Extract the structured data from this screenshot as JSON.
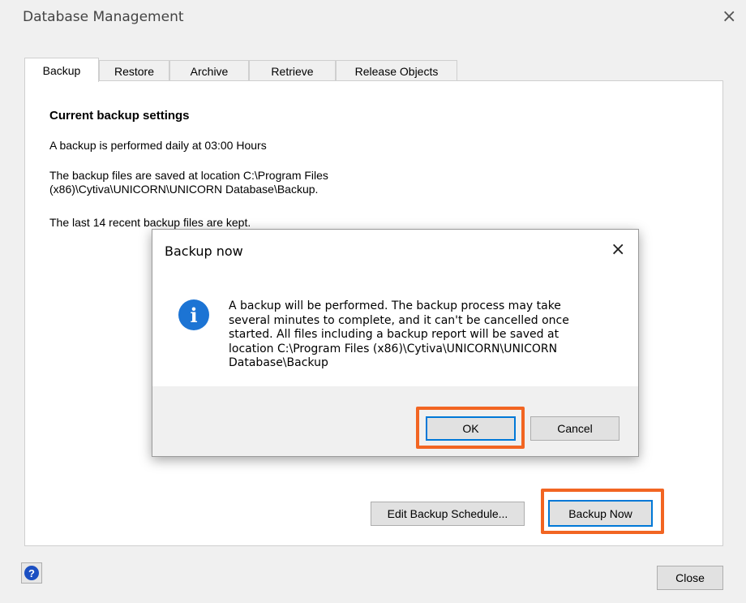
{
  "window": {
    "title": "Database Management",
    "close_glyph": "×"
  },
  "tabs": [
    {
      "label": "Backup",
      "active": true
    },
    {
      "label": "Restore",
      "active": false
    },
    {
      "label": "Archive",
      "active": false
    },
    {
      "label": "Retrieve",
      "active": false
    },
    {
      "label": "Release Objects",
      "active": false
    }
  ],
  "backup": {
    "section_title": "Current backup settings",
    "schedule_text": "A backup is performed daily at 03:00 Hours",
    "location_line1": "The backup files are saved at location C:\\Program Files",
    "location_line2": "(x86)\\Cytiva\\UNICORN\\UNICORN Database\\Backup.",
    "retention_text": "The last 14 recent backup files are kept.",
    "edit_schedule_label": "Edit Backup Schedule...",
    "backup_now_label": "Backup Now"
  },
  "footer": {
    "close_label": "Close",
    "help_glyph": "?"
  },
  "dialog": {
    "title": "Backup now",
    "close_glyph": "×",
    "icon_glyph": "i",
    "message_lines": [
      "A backup will be performed. The backup process may take",
      "several minutes to complete, and it can't be cancelled once",
      "started. All files including a backup report will be saved at",
      "location C:\\Program Files (x86)\\Cytiva\\UNICORN\\UNICORN",
      "Database\\Backup"
    ],
    "ok_label": "OK",
    "cancel_label": "Cancel"
  },
  "colors": {
    "highlight": "#f26522",
    "focus_border": "#0078d7",
    "info_icon": "#1c74d4"
  }
}
